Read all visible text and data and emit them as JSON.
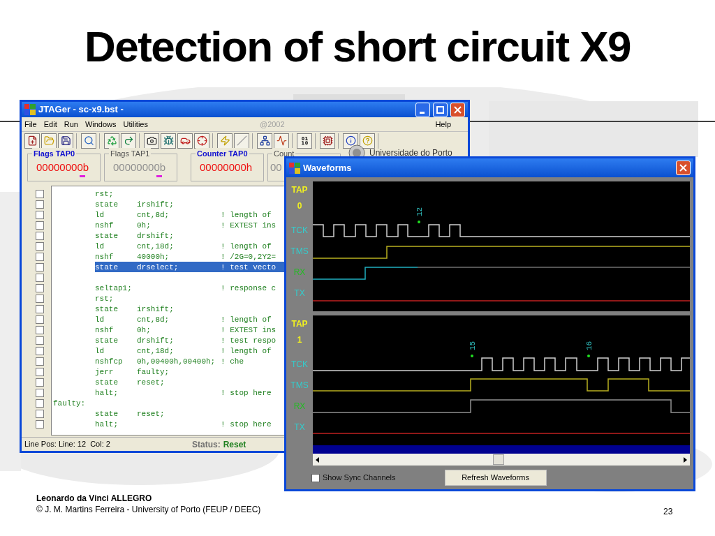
{
  "slide": {
    "title": "Detection of short circuit X9",
    "footer_title": "Leonardo da Vinci ALLEGRO",
    "footer_credit": "© J. M. Martins Ferreira - University of Porto (FEUP / DEEC)",
    "page_number": "23"
  },
  "main_window": {
    "title": "JTAGer - sc-x9.bst -",
    "menu": [
      "File",
      "Edit",
      "Run",
      "Windows",
      "Utilities"
    ],
    "menu_year": "@2002",
    "menu_help": "Help",
    "registers": [
      {
        "label": "Flags TAP0",
        "value": "00000000b",
        "kind": "flags",
        "selected": true
      },
      {
        "label": "Flags TAP1",
        "value": "00000000b",
        "kind": "flags",
        "selected": false
      },
      {
        "label": "Counter TAP0",
        "value": "00000000h",
        "kind": "counter",
        "selected": true
      },
      {
        "label": "Count",
        "value": "00",
        "kind": "counter",
        "selected": false
      }
    ],
    "institution": "Universidade do Porto",
    "lines": [
      {
        "kind": "instr",
        "op": "rst;",
        "checked": false,
        "selected": false
      },
      {
        "kind": "instr",
        "op": "state",
        "args": "irshift;",
        "checked": false,
        "selected": false
      },
      {
        "kind": "instr",
        "op": "ld",
        "args": "cnt,8d;",
        "comment": "! length of",
        "checked": false,
        "selected": false
      },
      {
        "kind": "instr",
        "op": "nshf",
        "args": "0h;",
        "comment": "! EXTEST ins",
        "checked": false,
        "selected": false
      },
      {
        "kind": "instr",
        "op": "state",
        "args": "drshift;",
        "checked": false,
        "selected": false
      },
      {
        "kind": "instr",
        "op": "ld",
        "args": "cnt,18d;",
        "comment": "! length of",
        "checked": false,
        "selected": false
      },
      {
        "kind": "instr",
        "op": "nshf",
        "args": "40000h;",
        "comment": "! /2G=0,2Y2=",
        "checked": false,
        "selected": false
      },
      {
        "kind": "instr",
        "op": "state",
        "args": "drselect;",
        "comment": "! test vecto",
        "checked": false,
        "selected": true
      },
      {
        "kind": "blank",
        "checked": false,
        "selected": false
      },
      {
        "kind": "instr",
        "op": "seltap1;",
        "comment": "! response c",
        "checked": false,
        "selected": false
      },
      {
        "kind": "instr",
        "op": "rst;",
        "checked": false,
        "selected": false
      },
      {
        "kind": "instr",
        "op": "state",
        "args": "irshift;",
        "checked": false,
        "selected": false
      },
      {
        "kind": "instr",
        "op": "ld",
        "args": "cnt,8d;",
        "comment": "! length of",
        "checked": false,
        "selected": false
      },
      {
        "kind": "instr",
        "op": "nshf",
        "args": "0h;",
        "comment": "! EXTEST ins",
        "checked": false,
        "selected": false
      },
      {
        "kind": "instr",
        "op": "state",
        "args": "drshift;",
        "comment": "! test respo",
        "checked": false,
        "selected": false
      },
      {
        "kind": "instr",
        "op": "ld",
        "args": "cnt,18d;",
        "comment": "! length of",
        "checked": false,
        "selected": false
      },
      {
        "kind": "instr",
        "op": "nshfcp",
        "args": "0h,00400h,00400h;",
        "comment": "! che",
        "checked": false,
        "selected": false
      },
      {
        "kind": "instr",
        "op": "jerr",
        "args": "faulty;",
        "checked": false,
        "selected": false
      },
      {
        "kind": "instr",
        "op": "state",
        "args": "reset;",
        "checked": false,
        "selected": false
      },
      {
        "kind": "instr",
        "op": "halt;",
        "comment": "! stop here",
        "checked": false,
        "selected": false
      },
      {
        "kind": "label",
        "op": "faulty:",
        "checked": false,
        "selected": false
      },
      {
        "kind": "instr",
        "op": "state",
        "args": "reset;",
        "checked": false,
        "selected": false
      },
      {
        "kind": "instr",
        "op": "halt;",
        "comment": "! stop here",
        "checked": false,
        "selected": false
      }
    ],
    "status_position": "Line Pos: Line: 12  Col: 2",
    "status_label": "Status:",
    "status_value": "Reset"
  },
  "waveforms_window": {
    "title": "Waveforms",
    "panels": [
      {
        "tap_label": "TAP",
        "tap_number": "0",
        "markers": [
          "12"
        ],
        "channels": [
          {
            "name": "TCK",
            "color": "#33cccc"
          },
          {
            "name": "TMS",
            "color": "#33cccc"
          },
          {
            "name": "RX",
            "color": "#22bb22"
          },
          {
            "name": "TX",
            "color": "#33cccc"
          }
        ]
      },
      {
        "tap_label": "TAP",
        "tap_number": "1",
        "markers": [
          "15",
          "16"
        ],
        "channels": [
          {
            "name": "TCK",
            "color": "#33cccc"
          },
          {
            "name": "TMS",
            "color": "#33cccc"
          },
          {
            "name": "RX",
            "color": "#22bb22"
          },
          {
            "name": "TX",
            "color": "#33cccc"
          }
        ]
      }
    ],
    "show_sync": {
      "label": "Show Sync Channels",
      "checked": false
    },
    "refresh_button": "Refresh Waveforms"
  }
}
